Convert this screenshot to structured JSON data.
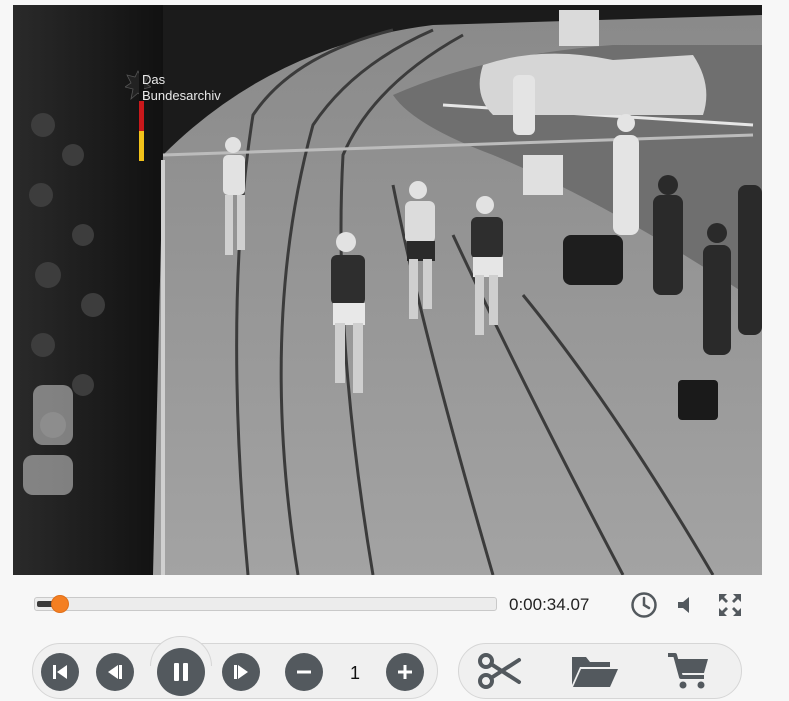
{
  "video": {
    "watermark": {
      "line1": "Das",
      "line2": "Bundesarchiv"
    },
    "scene_description_icon": "film-frame"
  },
  "seek": {
    "progress_fraction": 0.05,
    "time": "0:00:34.07"
  },
  "top_icons": [
    "clock-icon",
    "volume-icon",
    "fullscreen-icon"
  ],
  "controls": {
    "speed_value": "1",
    "buttons": [
      "skip-to-start",
      "step-back",
      "pause",
      "step-forward",
      "speed-decrease",
      "speed-increase"
    ]
  },
  "tools": [
    "scissors-icon",
    "folder-open-icon",
    "cart-icon"
  ],
  "colors": {
    "accent": "#f47f22",
    "button": "#53595e",
    "background": "#f7f7f7"
  }
}
